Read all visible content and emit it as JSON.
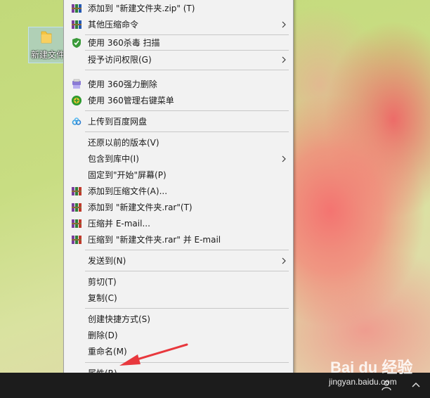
{
  "desktop": {
    "folder_label": "新建文件"
  },
  "context_menu": {
    "items": [
      {
        "label": "添加到 \"新建文件夹.zip\" (T)",
        "icon": "winrar-icon"
      },
      {
        "label": "其他压缩命令",
        "icon": "winrar-icon",
        "submenu": true
      },
      {
        "label": "使用 360杀毒 扫描",
        "icon": "360-antivirus-shield-icon"
      },
      {
        "label": "授予访问权限(G)",
        "submenu": true
      },
      {
        "label": "使用 360强力删除",
        "icon": "360-shredder-icon"
      },
      {
        "label": "使用 360管理右键菜单",
        "icon": "360-menu-manager-icon"
      },
      {
        "label": "上传到百度网盘",
        "icon": "baidu-cloud-icon"
      },
      {
        "label": "还原以前的版本(V)"
      },
      {
        "label": "包含到库中(I)",
        "submenu": true
      },
      {
        "label": "固定到\"开始\"屏幕(P)"
      },
      {
        "label": "添加到压缩文件(A)...",
        "icon": "winrar-icon"
      },
      {
        "label": "添加到 \"新建文件夹.rar\"(T)",
        "icon": "winrar-icon"
      },
      {
        "label": "压缩并 E-mail...",
        "icon": "winrar-icon"
      },
      {
        "label": "压缩到 \"新建文件夹.rar\" 并 E-mail",
        "icon": "winrar-icon"
      },
      {
        "label": "发送到(N)",
        "submenu": true
      },
      {
        "label": "剪切(T)"
      },
      {
        "label": "复制(C)"
      },
      {
        "label": "创建快捷方式(S)"
      },
      {
        "label": "删除(D)"
      },
      {
        "label": "重命名(M)"
      },
      {
        "label": "属性(R)"
      }
    ]
  },
  "watermark": {
    "brand": "Bai du 经验",
    "url": "jingyan.baidu.com"
  },
  "colors": {
    "menu_bg": "#f2f2f2",
    "annotation_arrow": "#e8383d",
    "taskbar": "#1c1c1c"
  }
}
